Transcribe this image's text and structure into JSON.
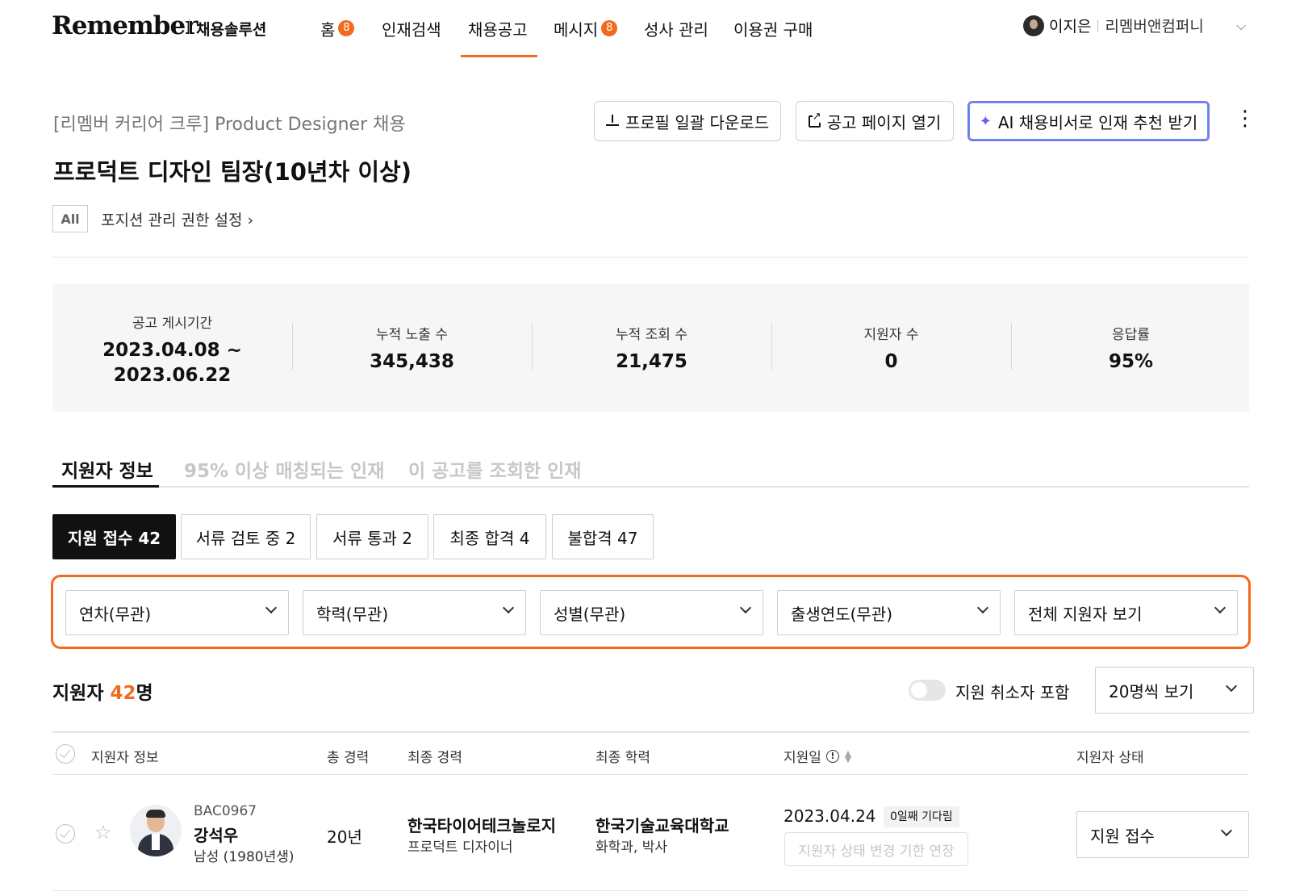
{
  "header": {
    "logo": "Remember",
    "logo_sub": "채용솔루션",
    "nav": [
      {
        "label": "홈",
        "badge": "8"
      },
      {
        "label": "인재검색",
        "badge": null
      },
      {
        "label": "채용공고",
        "badge": null,
        "active": true
      },
      {
        "label": "메시지",
        "badge": "8"
      },
      {
        "label": "성사 관리",
        "badge": null
      },
      {
        "label": "이용권 구매",
        "badge": null
      }
    ],
    "user": {
      "name": "이지은",
      "company": "리멤버앤컴퍼니"
    }
  },
  "job": {
    "subtitle": "[리멤버 커리어 크루] Product Designer 채용",
    "title": "프로덕트 디자인 팀장(10년차 이상)",
    "scope_badge": "All",
    "permission_link": "포지션 관리 권한 설정 ›"
  },
  "actions": {
    "download": "프로필 일괄 다운로드",
    "open_page": "공고 페이지 열기",
    "ai_recommend": "AI 채용비서로 인재 추천 받기",
    "more": "⋮"
  },
  "stats": [
    {
      "label": "공고 게시기간",
      "value": "2023.04.08 ~\n2023.06.22"
    },
    {
      "label": "누적 노출 수",
      "value": "345,438"
    },
    {
      "label": "누적 조회 수",
      "value": "21,475"
    },
    {
      "label": "지원자 수",
      "value": "0"
    },
    {
      "label": "응답률",
      "value": "95%"
    }
  ],
  "tabs": [
    "지원자 정보",
    "95% 이상 매칭되는 인재",
    "이 공고를 조회한 인재"
  ],
  "status_chips": [
    "지원 접수 42",
    "서류 검토 중 2",
    "서류 통과 2",
    "최종 합격 4",
    "불합격 47"
  ],
  "filters": [
    "연차(무관)",
    "학력(무관)",
    "성별(무관)",
    "출생연도(무관)",
    "전체 지원자 보기"
  ],
  "applicants": {
    "title_prefix": "지원자 ",
    "count": "42",
    "title_suffix": "명",
    "toggle_label": "지원 취소자 포함",
    "page_size": "20명씩 보기"
  },
  "table": {
    "headers": [
      "지원자 정보",
      "총 경력",
      "최종 경력",
      "최종 학력",
      "지원일",
      "지원자 상태"
    ],
    "rows": [
      {
        "code": "BAC0967",
        "name": "강석우",
        "meta": "남성 (1980년생)",
        "years": "20년",
        "company": "한국타이어테크놀로지",
        "position": "프로덕트 디자이너",
        "school": "한국기술교육대학교",
        "major": "화학과, 박사",
        "date": "2023.04.24",
        "wait": "0일째 기다림",
        "extend": "지원자 상태 변경 기한 연장",
        "status": "지원 접수"
      }
    ]
  },
  "colors": {
    "accent": "#f26b1d",
    "ai_border": "#8a6cf0"
  }
}
